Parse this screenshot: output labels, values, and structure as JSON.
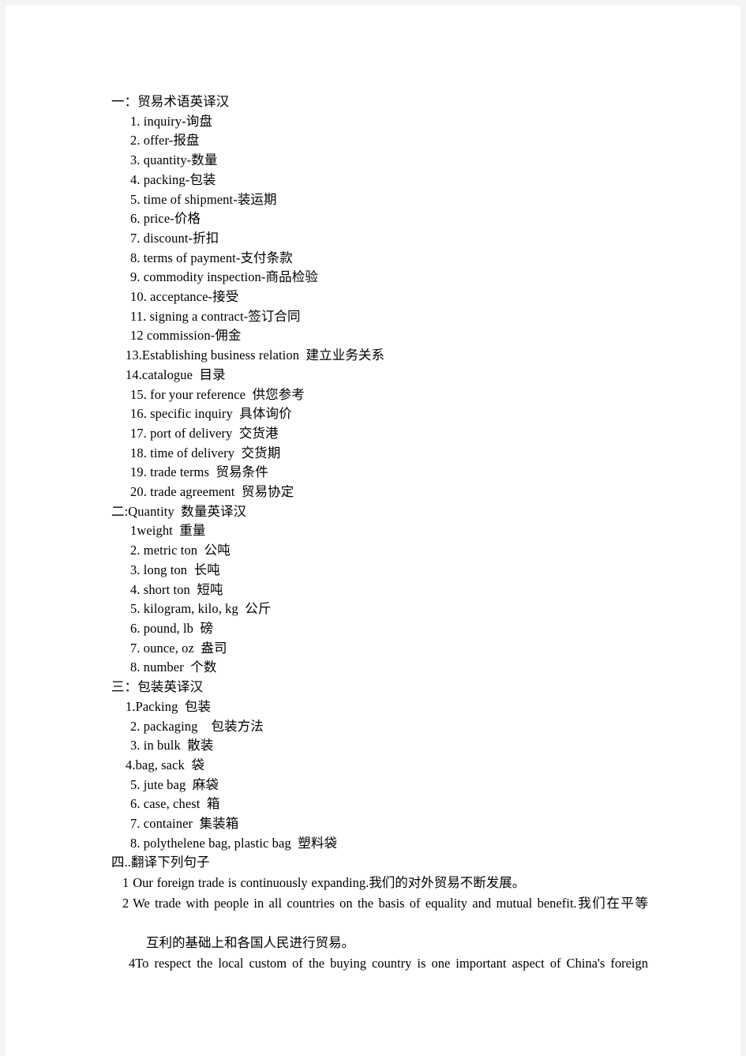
{
  "document": {
    "page_background": "#ffffff",
    "surround_background": "#f4f4f4",
    "text_color": "#000000"
  },
  "sections": [
    {
      "heading": "一：贸易术语英译汉",
      "items": [
        "1. inquiry-询盘",
        "2. offer-报盘",
        "3. quantity-数量",
        "4. packing-包装",
        "5. time of shipment-装运期",
        "6. price-价格",
        "7. discount-折扣",
        "8. terms of payment-支付条款",
        "9. commodity inspection-商品检验",
        "10. acceptance-接受",
        "11. signing a contract-签订合同",
        "12 commission-佣金",
        "13.Establishing business relation  建立业务关系",
        "14.catalogue  目录",
        "15. for your reference  供您参考",
        "16. specific inquiry  具体询价",
        "17. port of delivery  交货港",
        "18. time of delivery  交货期",
        "19. trade terms  贸易条件",
        "20. trade agreement  贸易协定"
      ]
    },
    {
      "heading": "二:Quantity  数量英译汉",
      "items": [
        "1weight  重量",
        "2. metric ton  公吨",
        "3. long ton  长吨",
        "4. short ton  短吨",
        "5. kilogram, kilo, kg  公斤",
        "6. pound, lb  磅",
        "7. ounce, oz  盎司",
        "8. number  个数"
      ]
    },
    {
      "heading": "三：包装英译汉",
      "items": [
        "1.Packing  包装",
        "2. packaging    包装方法",
        "3. in bulk  散装",
        "4.bag, sack  袋",
        "5. jute bag  麻袋",
        "6. case, chest  箱",
        "7. container  集装箱",
        "8. polythelene bag, plastic bag  塑料袋"
      ]
    },
    {
      "heading": "四..翻译下列句子",
      "sentences": [
        {
          "number": "1",
          "english": "Our foreign trade is continuously expanding.",
          "chinese": "我们的对外贸易不断发展。"
        },
        {
          "number": "2",
          "english": "We trade with people in all countries on the basis of equality and mutual benefit.",
          "chinese": "我们在平等",
          "continuation": "互利的基础上和各国人民进行贸易。"
        },
        {
          "number": "4",
          "english": "To respect the local custom of the buying country is one important aspect of China's foreign",
          "chinese": ""
        }
      ]
    }
  ]
}
